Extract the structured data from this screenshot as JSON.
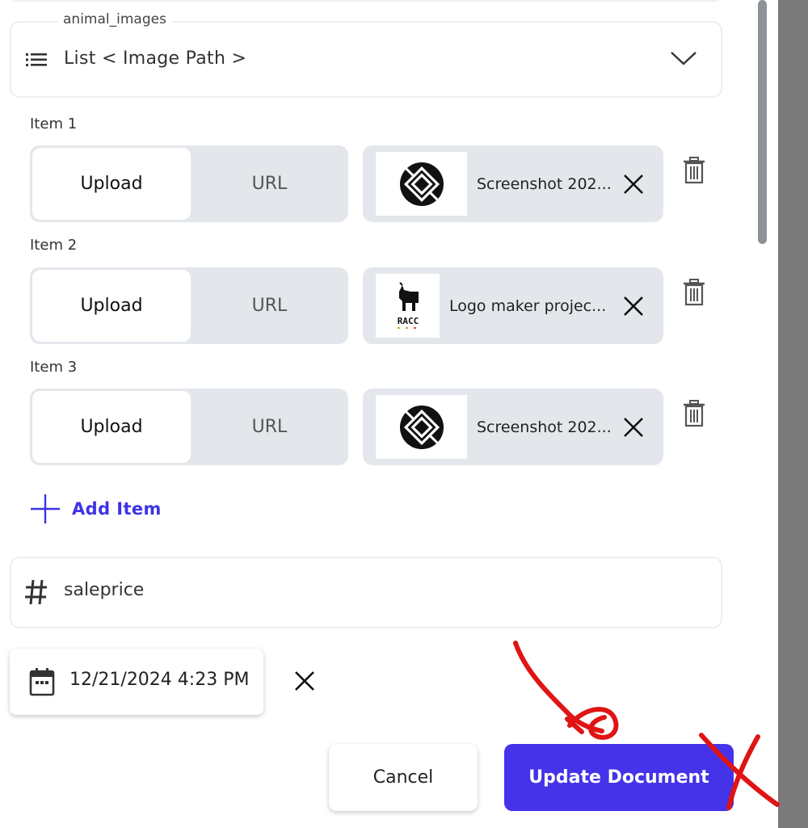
{
  "list_field": {
    "legend": "animal_images",
    "title": "List < Image Path >",
    "icon": "list-icon"
  },
  "items": [
    {
      "label": "Item 1",
      "upload_label": "Upload",
      "url_label": "URL",
      "file_name": "Screenshot 202...",
      "thumb": "geometric-logo"
    },
    {
      "label": "Item 2",
      "upload_label": "Upload",
      "url_label": "URL",
      "file_name": "Logo maker projec...",
      "thumb": "goat-logo"
    },
    {
      "label": "Item 3",
      "upload_label": "Upload",
      "url_label": "URL",
      "file_name": "Screenshot 202...",
      "thumb": "geometric-logo"
    }
  ],
  "thumb_text": {
    "goat_logo": "RACC"
  },
  "add_item_label": "Add Item",
  "number_field": {
    "label": "saleprice",
    "icon": "hash-icon"
  },
  "date_field": {
    "value": "12/21/2024 4:23 PM",
    "icon": "calendar-icon"
  },
  "actions": {
    "cancel_label": "Cancel",
    "update_label": "Update Document"
  },
  "colors": {
    "accent": "#4433e8",
    "annotation": "#e01414",
    "chip_bg": "#e3e7eb"
  }
}
